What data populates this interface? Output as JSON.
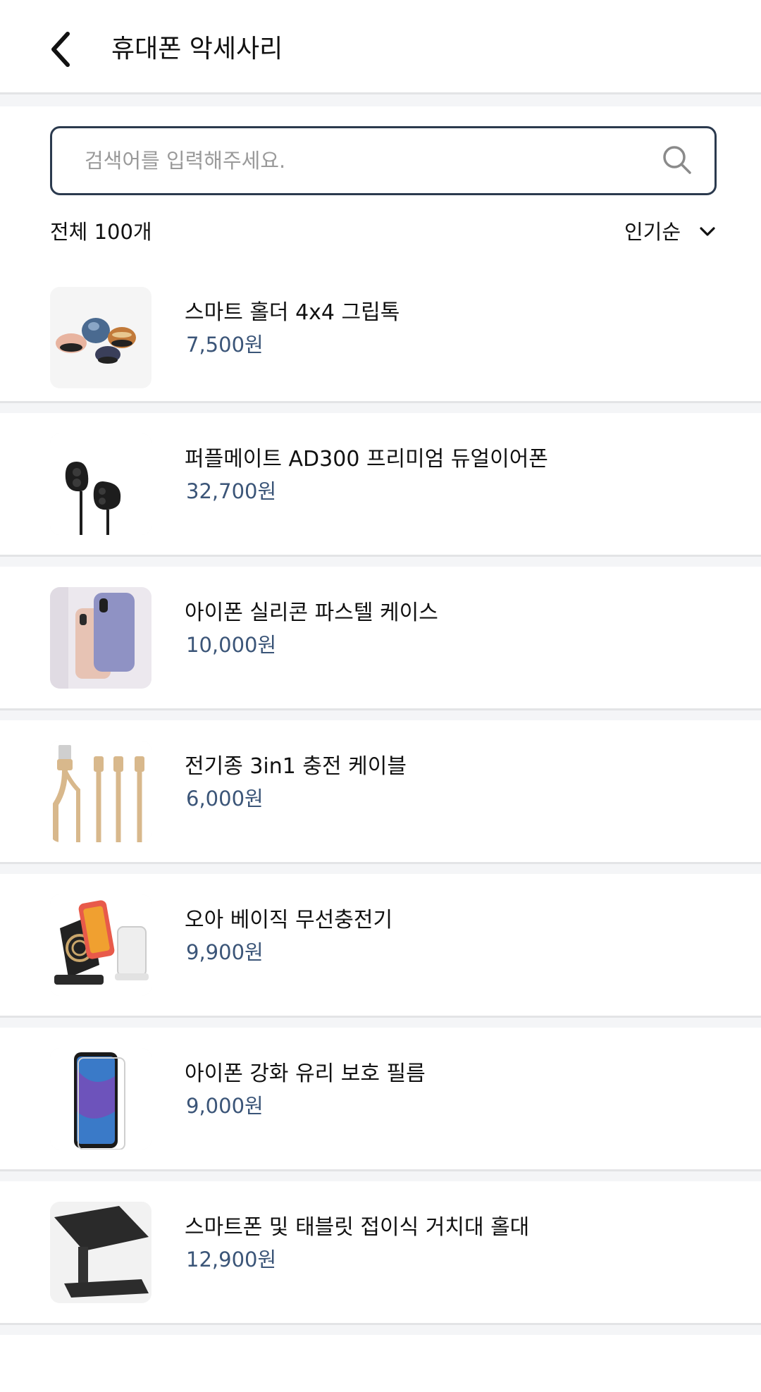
{
  "header": {
    "title": "휴대폰 악세사리",
    "back_icon": "chevron-left-icon"
  },
  "search": {
    "placeholder": "검색어를 입력해주세요.",
    "value": "",
    "icon": "search-icon"
  },
  "list_meta": {
    "count_label": "전체 100개",
    "sort_label": "인기순",
    "sort_icon": "chevron-down-icon"
  },
  "colors": {
    "price": "#3b5578",
    "search_border": "#2b3a4e",
    "divider": "#e3e4e6"
  },
  "products": [
    {
      "name": "스마트 홀더 4x4 그립톡",
      "price": "7,500원",
      "image": "grip-holders-image"
    },
    {
      "name": "퍼플메이트 AD300 프리미엄 듀얼이어폰",
      "price": "32,700원",
      "image": "earphones-image"
    },
    {
      "name": "아이폰 실리콘 파스텔 케이스",
      "price": "10,000원",
      "image": "phone-cases-image"
    },
    {
      "name": "전기종 3in1 충전 케이블",
      "price": "6,000원",
      "image": "charging-cable-image"
    },
    {
      "name": "오아 베이직 무선충전기",
      "price": "9,900원",
      "image": "wireless-charger-image"
    },
    {
      "name": "아이폰 강화 유리 보호 필름",
      "price": "9,000원",
      "image": "screen-protector-image"
    },
    {
      "name": "스마트폰 및 태블릿 접이식 거치대 홀대",
      "price": "12,900원",
      "image": "phone-stand-image"
    }
  ]
}
